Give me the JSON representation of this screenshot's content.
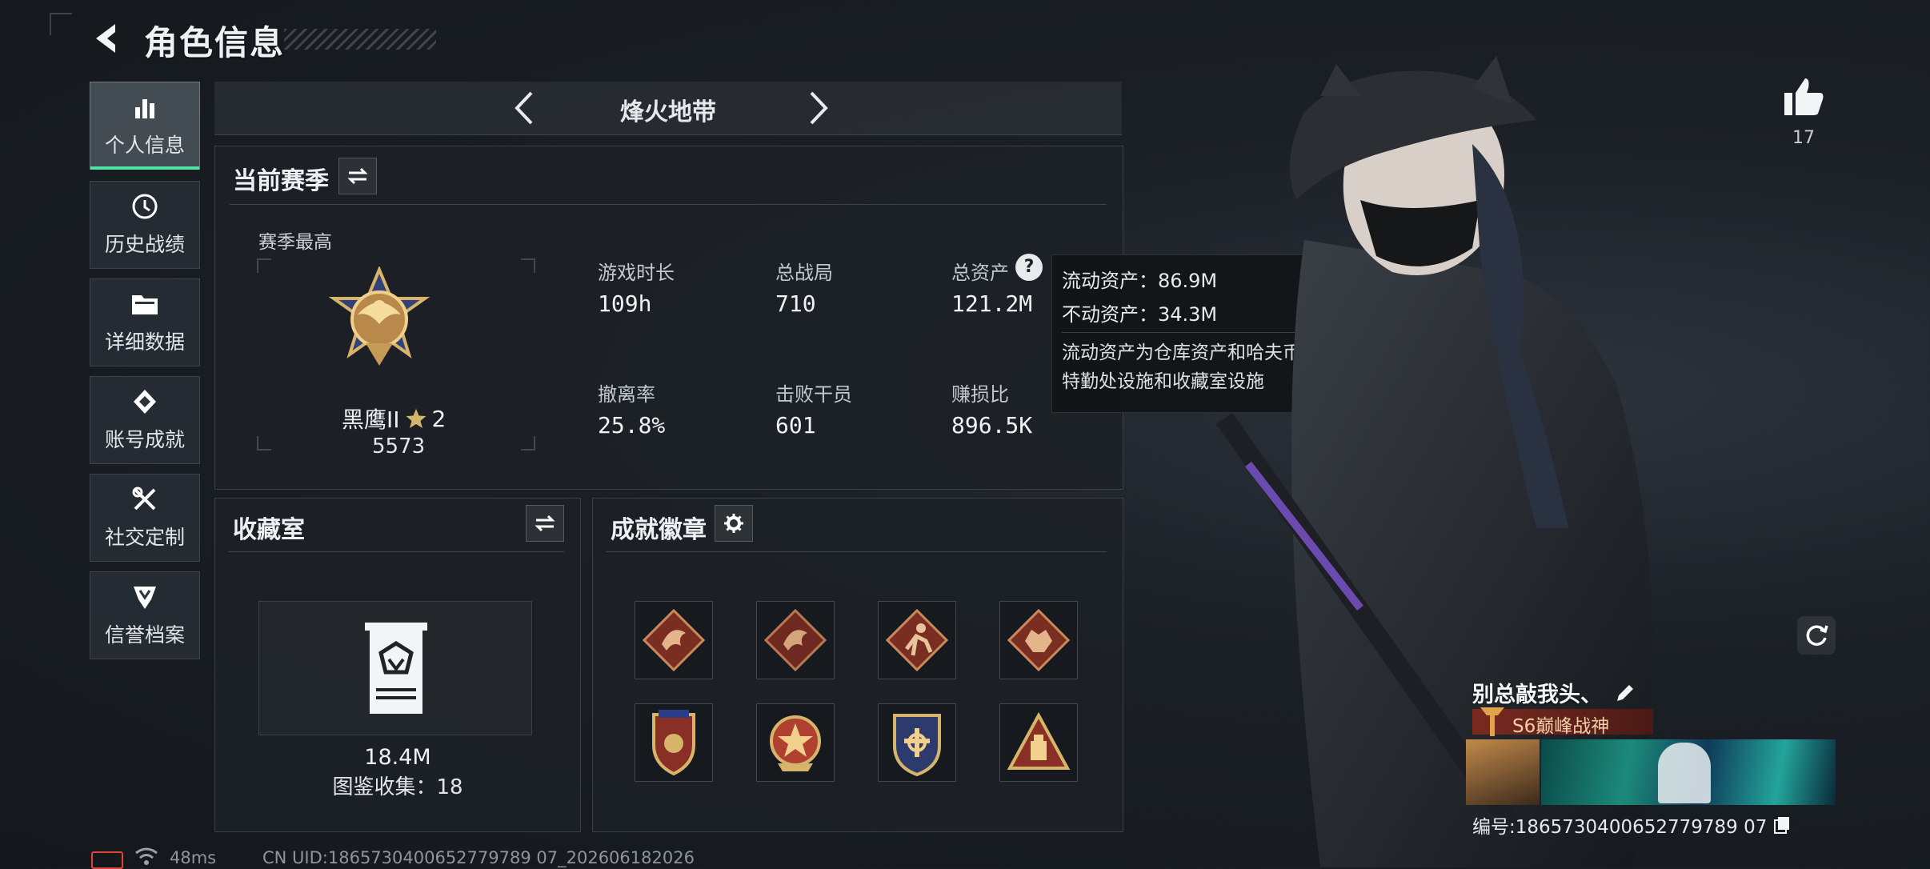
{
  "header": {
    "title": "角色信息"
  },
  "nav": [
    {
      "label": "个人信息",
      "icon": "bar-chart-icon",
      "active": true
    },
    {
      "label": "历史战绩",
      "icon": "history-icon",
      "active": false
    },
    {
      "label": "详细数据",
      "icon": "folder-icon",
      "active": false
    },
    {
      "label": "账号成就",
      "icon": "achievement-icon",
      "active": false
    },
    {
      "label": "社交定制",
      "icon": "tools-icon",
      "active": false
    },
    {
      "label": "信誉档案",
      "icon": "credit-icon",
      "active": false
    }
  ],
  "mode": {
    "name": "烽火地带"
  },
  "season": {
    "title": "当前赛季",
    "best_label": "赛季最高",
    "rank_name": "黑鹰II",
    "rank_stars": "2",
    "rank_points": "5573",
    "stats": [
      {
        "label": "游戏时长",
        "value": "109h"
      },
      {
        "label": "总战局",
        "value": "710"
      },
      {
        "label": "总资产",
        "value": "121.2M"
      },
      {
        "label": "撤离率",
        "value": "25.8%"
      },
      {
        "label": "击败干员",
        "value": "601"
      },
      {
        "label": "赚损比",
        "value": "896.5K"
      }
    ]
  },
  "tooltip": {
    "liquid": "流动资产：86.9M",
    "fixed": "不动资产：34.3M",
    "desc": "流动资产为仓库资产和哈夫币，不动资产为特勤处设施和收藏室设施"
  },
  "collection": {
    "title": "收藏室",
    "value": "18.4M",
    "catalog": "图鉴收集：18"
  },
  "achievements": {
    "title": "成就徽章",
    "badges": [
      "dragon-badge-icon",
      "dragon-badge-icon",
      "runner-badge-icon",
      "beast-badge-icon",
      "shield-star-badge-icon",
      "star-shield-badge-icon",
      "crest-badge-icon",
      "triangle-badge-icon"
    ]
  },
  "likes": {
    "count": "17"
  },
  "profile": {
    "name": "别总敲我头、",
    "title_badge": "S6巅峰战神",
    "id_text": "编号:1865730400652779789 07"
  },
  "status": {
    "ping": "48ms",
    "uid": "CN UID:1865730400652779789 07_202606182026"
  },
  "colors": {
    "accent": "#4fe3a6",
    "gold": "#d6b46a",
    "badge_red": "#7a2e22"
  }
}
